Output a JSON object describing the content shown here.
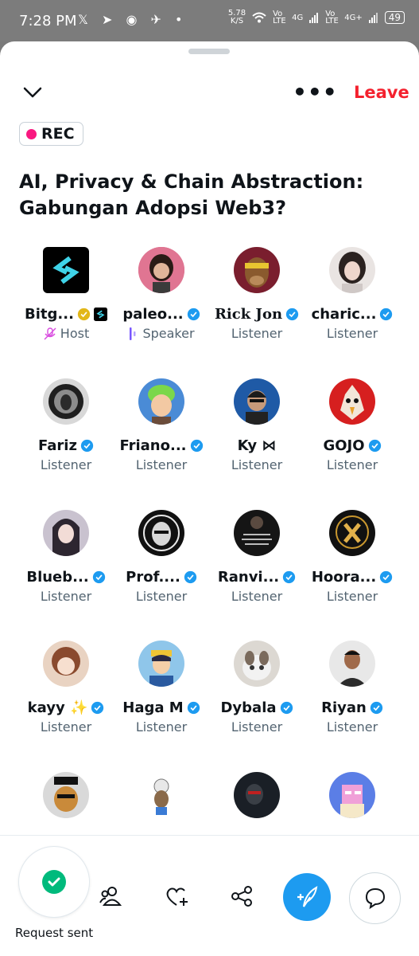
{
  "status_bar": {
    "time": "7:28 PM",
    "net_speed": "5.78",
    "net_unit": "K/S",
    "sim1": "Vo LTE",
    "sim1_net": "4G",
    "sim2": "Vo LTE",
    "sim2_net": "4G+",
    "battery": "49"
  },
  "header": {
    "leave_label": "Leave"
  },
  "rec": {
    "label": "REC"
  },
  "space": {
    "title": "AI, Privacy & Chain Abstraction: Gabungan Adopsi Web3?"
  },
  "participants": [
    {
      "name": "Bitg...",
      "role": "Host"
    },
    {
      "name": "paleo...",
      "role": "Speaker"
    },
    {
      "name": "Rick Jon",
      "role": "Listener"
    },
    {
      "name": "charic...",
      "role": "Listener"
    },
    {
      "name": "Fariz",
      "role": "Listener"
    },
    {
      "name": "Friano...",
      "role": "Listener"
    },
    {
      "name": "Ky ⋈",
      "role": "Listener"
    },
    {
      "name": "GOJO",
      "role": "Listener"
    },
    {
      "name": "Blueb...",
      "role": "Listener"
    },
    {
      "name": "Prof....",
      "role": "Listener"
    },
    {
      "name": "Ranvi...",
      "role": "Listener"
    },
    {
      "name": "Hoora...",
      "role": "Listener"
    },
    {
      "name": "kayy ✨",
      "role": "Listener"
    },
    {
      "name": "Haga M",
      "role": "Listener"
    },
    {
      "name": "Dybala",
      "role": "Listener"
    },
    {
      "name": "Riyan",
      "role": "Listener"
    },
    {
      "name": "",
      "role": ""
    },
    {
      "name": "",
      "role": ""
    },
    {
      "name": "",
      "role": ""
    },
    {
      "name": "",
      "role": ""
    }
  ],
  "footer": {
    "request_label": "Request sent"
  },
  "colors": {
    "accent": "#1d9bf0",
    "leave": "#f4212e",
    "rec_dot": "#f91880",
    "check": "#00ba7c",
    "verified": "#1d9bf0",
    "gold": "#e2b719"
  }
}
